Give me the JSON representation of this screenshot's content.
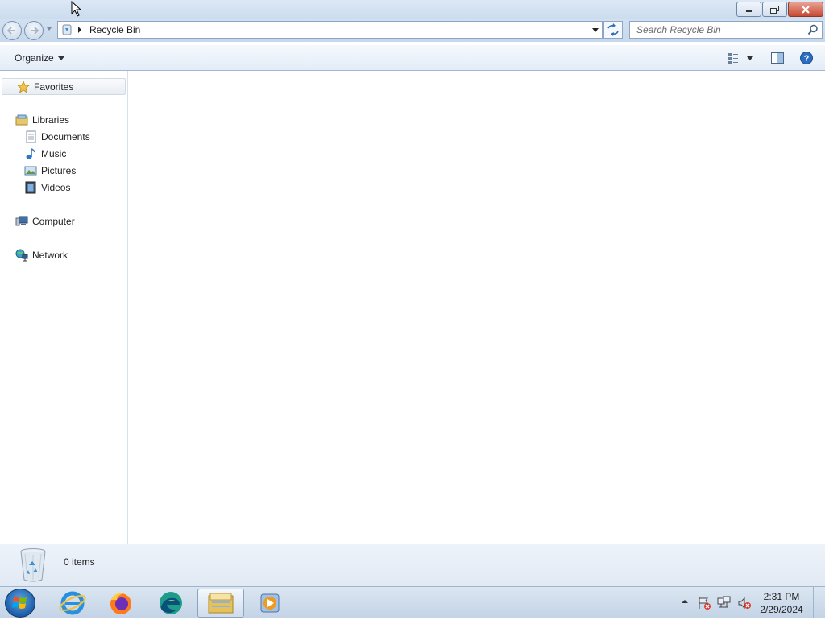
{
  "window": {
    "minimize_label": "Minimize",
    "maximize_label": "Restore",
    "close_label": "Close"
  },
  "address_bar": {
    "path": "Recycle Bin"
  },
  "search": {
    "placeholder": "Search Recycle Bin"
  },
  "command_bar": {
    "organize_label": "Organize"
  },
  "navigation": {
    "favorites": "Favorites",
    "libraries": "Libraries",
    "library_items": [
      "Documents",
      "Music",
      "Pictures",
      "Videos"
    ],
    "computer": "Computer",
    "network": "Network"
  },
  "details": {
    "item_count": "0 items"
  },
  "taskbar": {
    "apps": [
      "internet-explorer",
      "firefox",
      "edge",
      "windows-explorer",
      "media-player"
    ],
    "active_app": "windows-explorer",
    "clock_time": "2:31 PM",
    "clock_date": "2/29/2024"
  },
  "colors": {
    "chrome_blue": "#cbdcee",
    "close_red": "#c74a34",
    "accent": "#1d5ca6"
  }
}
